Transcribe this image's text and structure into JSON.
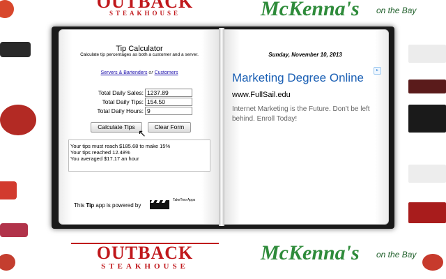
{
  "background": {
    "logo_outback": "OUTBACK",
    "logo_outback_sub": "STEAKHOUSE",
    "logo_mckennas": "McKenna's",
    "logo_mckennas_sub": "on the Bay"
  },
  "calculator": {
    "title": "Tip Calculator",
    "subtitle": "Calculate tip percentages as both a customer and a server.",
    "link_servers": "Servers & Bartenders",
    "link_or": "or",
    "link_customers": "Customers",
    "fields": [
      {
        "label": "Total Daily Sales:",
        "value": "1237.89"
      },
      {
        "label": "Total Daily Tips:",
        "value": "154.50"
      },
      {
        "label": "Total Daily Hours:",
        "value": "9"
      }
    ],
    "calculate_label": "Calculate Tips",
    "clear_label": "Clear Form",
    "results": [
      "Your tips must reach $185.68 to make 15%",
      "Your tips reached 12.48%",
      "You averaged $17.17 an hour"
    ],
    "footer_pre": "This ",
    "footer_bold": "Tip",
    "footer_post": " app is powered by",
    "brand_line1": "TakeTwo Apps"
  },
  "right_page": {
    "date": "Sunday, November 10, 2013",
    "ad_title": "Marketing Degree Online",
    "ad_url": "www.FullSail.edu",
    "ad_body": "Internet Marketing is the Future. Don't be left behind. Enroll Today!"
  },
  "colors": {
    "link": "#1a0dab",
    "ad_title": "#1a5fb4",
    "brand_red": "#c0181c",
    "brand_green": "#2e8b3a"
  }
}
